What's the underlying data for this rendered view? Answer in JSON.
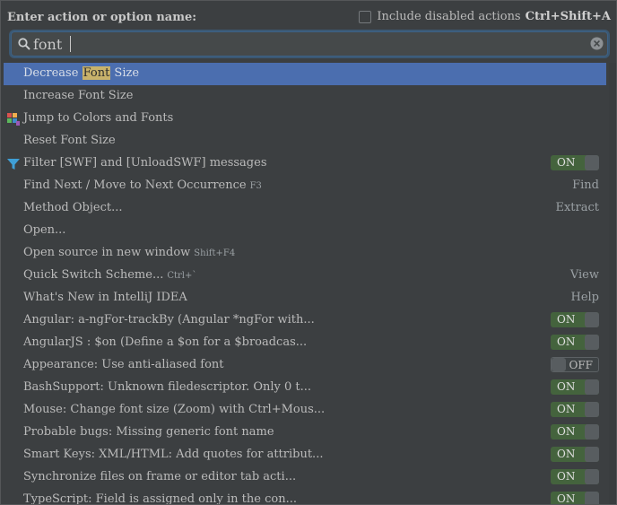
{
  "header": {
    "prompt": "Enter action or option name:",
    "include_label": "Include disabled actions",
    "include_shortcut": "Ctrl+Shift+A"
  },
  "search": {
    "value": "font"
  },
  "items": [
    {
      "pre": "Decrease ",
      "match": "Font",
      "post": " Size",
      "hint": "",
      "right": "",
      "toggle": "",
      "icon": ""
    },
    {
      "pre": "Increase Font Size",
      "match": "",
      "post": "",
      "hint": "",
      "right": "",
      "toggle": "",
      "icon": ""
    },
    {
      "pre": "Jump to Colors and Fonts",
      "match": "",
      "post": "",
      "hint": "",
      "right": "",
      "toggle": "",
      "icon": "palette-icon"
    },
    {
      "pre": "Reset Font Size",
      "match": "",
      "post": "",
      "hint": "",
      "right": "",
      "toggle": "",
      "icon": ""
    },
    {
      "pre": "Filter [SWF] and [UnloadSWF] messages",
      "match": "",
      "post": "",
      "hint": "",
      "right": "",
      "toggle": "ON",
      "icon": "filter-icon"
    },
    {
      "pre": "Find Next / Move to Next Occurrence",
      "match": "",
      "post": "",
      "hint": "F3",
      "right": "Find",
      "toggle": "",
      "icon": ""
    },
    {
      "pre": "Method Object...",
      "match": "",
      "post": "",
      "hint": "",
      "right": "Extract",
      "toggle": "",
      "icon": ""
    },
    {
      "pre": "Open...",
      "match": "",
      "post": "",
      "hint": "",
      "right": "",
      "toggle": "",
      "icon": ""
    },
    {
      "pre": "Open source in new window",
      "match": "",
      "post": "",
      "hint": "Shift+F4",
      "right": "",
      "toggle": "",
      "icon": ""
    },
    {
      "pre": "Quick Switch Scheme...",
      "match": "",
      "post": "",
      "hint": "Ctrl+`",
      "right": "View",
      "toggle": "",
      "icon": ""
    },
    {
      "pre": "What's New in IntelliJ IDEA",
      "match": "",
      "post": "",
      "hint": "",
      "right": "Help",
      "toggle": "",
      "icon": ""
    },
    {
      "pre": "Angular: a-ngFor-trackBy (Angular *ngFor with...",
      "match": "",
      "post": "",
      "hint": "",
      "right": "",
      "toggle": "ON",
      "icon": ""
    },
    {
      "pre": "AngularJS : $on (Define a $on for a $broadcas...",
      "match": "",
      "post": "",
      "hint": "",
      "right": "",
      "toggle": "ON",
      "icon": ""
    },
    {
      "pre": "Appearance: Use anti-aliased font",
      "match": "",
      "post": "",
      "hint": "",
      "right": "",
      "toggle": "OFF",
      "icon": ""
    },
    {
      "pre": "BashSupport: Unknown filedescriptor. Only 0 t...",
      "match": "",
      "post": "",
      "hint": "",
      "right": "",
      "toggle": "ON",
      "icon": ""
    },
    {
      "pre": "Mouse: Change font size (Zoom) with Ctrl+Mous...",
      "match": "",
      "post": "",
      "hint": "",
      "right": "",
      "toggle": "ON",
      "icon": ""
    },
    {
      "pre": "Probable bugs: Missing generic font name",
      "match": "",
      "post": "",
      "hint": "",
      "right": "",
      "toggle": "ON",
      "icon": ""
    },
    {
      "pre": "Smart Keys: XML/HTML: Add quotes for attribut...",
      "match": "",
      "post": "",
      "hint": "",
      "right": "",
      "toggle": "ON",
      "icon": ""
    },
    {
      "pre": "Synchronize files on frame or editor tab acti...",
      "match": "",
      "post": "",
      "hint": "",
      "right": "",
      "toggle": "ON",
      "icon": ""
    },
    {
      "pre": "TypeScript: Field is assigned only in the con...",
      "match": "",
      "post": "",
      "hint": "",
      "right": "",
      "toggle": "ON",
      "icon": ""
    }
  ],
  "colors": {
    "background": "#3c3f41",
    "selection": "#4b6eaf",
    "match_highlight": "#c8b26b",
    "toggle_on": "#44633d"
  }
}
